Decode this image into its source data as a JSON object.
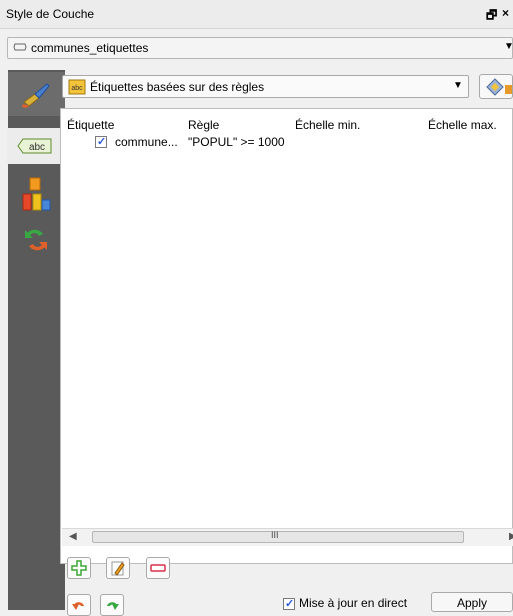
{
  "window": {
    "title": "Style de Couche",
    "float_glyph": "🗗",
    "close_glyph": "×"
  },
  "layer_select": {
    "value": "communes_etiquettes",
    "icon": "layer-outline-icon"
  },
  "sidebar": {
    "items": [
      {
        "icon": "paintbrush-icon",
        "label": "Style"
      },
      {
        "icon": "abc-label-icon",
        "label": "abc"
      },
      {
        "icon": "diagram-icon",
        "label": "Diagrams"
      },
      {
        "icon": "actions-icon",
        "label": "Actions"
      }
    ]
  },
  "labeling_mode": {
    "value": "Étiquettes basées sur des règles",
    "icon": "rule-labels-icon"
  },
  "table": {
    "columns": [
      "Étiquette",
      "Règle",
      "Échelle min.",
      "Échelle max."
    ],
    "rows": [
      {
        "checked": true,
        "label": "commune...",
        "rule": "\"POPUL\" >= 1000",
        "scale_min": "",
        "scale_max": ""
      }
    ]
  },
  "scrollbar": {
    "left_arrow": "◀",
    "right_arrow": "▶",
    "grip": "III"
  },
  "bottom": {
    "live_update_checked": true,
    "live_update_label": "Mise à jour en direct",
    "apply_label": "Apply"
  },
  "colors": {
    "sidebar_bg": "#5a5a5a",
    "add_green": "#3aa832",
    "remove_red": "#d9324a",
    "checkbox_blue": "#2a5bd7"
  }
}
